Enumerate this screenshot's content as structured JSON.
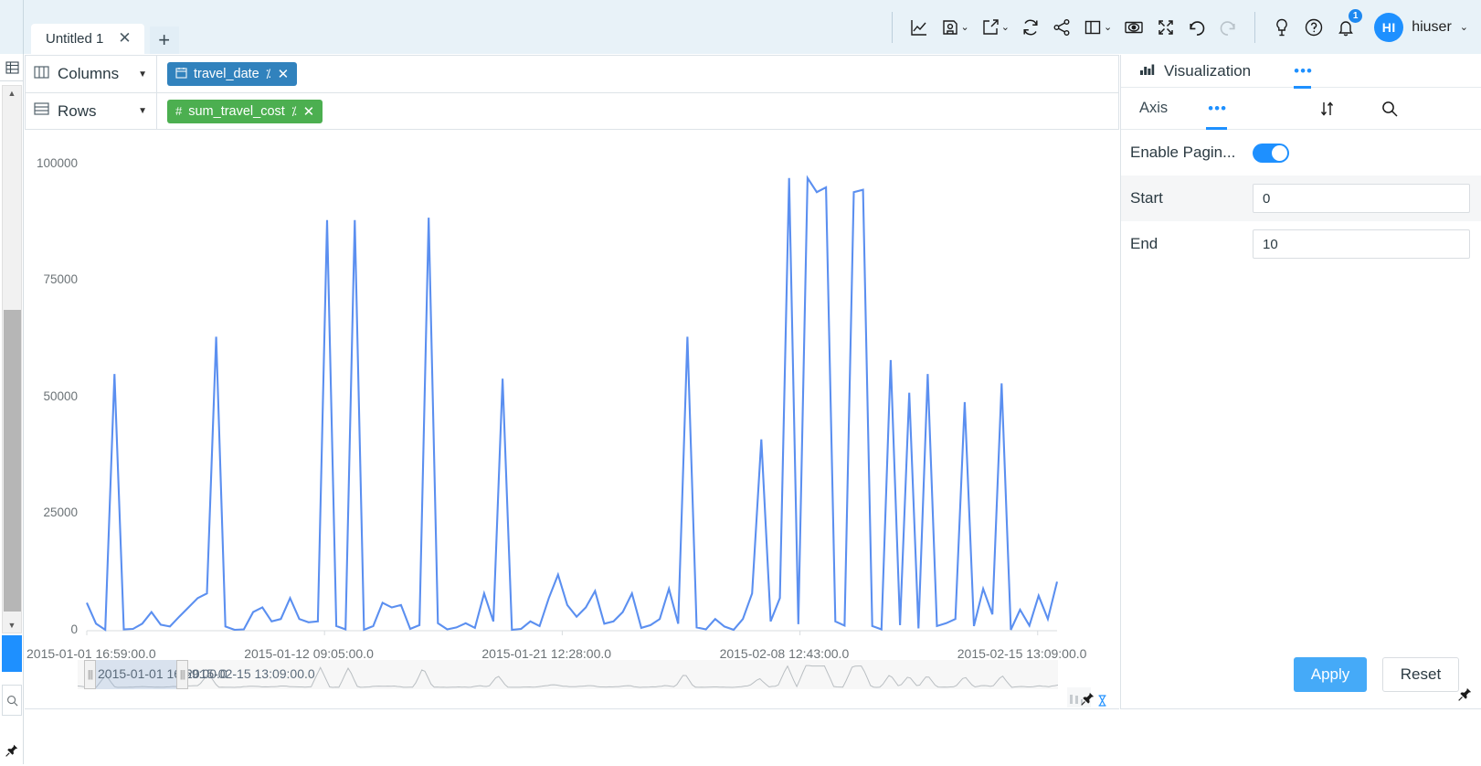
{
  "topbar": {
    "tabs": [
      {
        "label": "Untitled 1",
        "close": "✕"
      }
    ],
    "add_tab": "+",
    "tools": [
      {
        "name": "line-chart-icon",
        "caret": false
      },
      {
        "name": "save-icon",
        "caret": true
      },
      {
        "name": "export-icon",
        "caret": true
      },
      {
        "name": "refresh-icon",
        "caret": false
      },
      {
        "name": "share-icon",
        "caret": false
      },
      {
        "name": "layout-icon",
        "caret": true
      },
      {
        "name": "preview-eye-icon",
        "caret": false
      },
      {
        "name": "fullscreen-icon",
        "caret": false
      },
      {
        "name": "undo-icon",
        "caret": false
      },
      {
        "name": "redo-icon",
        "caret": false
      }
    ],
    "help_tools": [
      {
        "name": "lightbulb-icon"
      },
      {
        "name": "question-icon"
      }
    ],
    "notification_count": "1",
    "user": {
      "initials": "HI",
      "name": "hiuser",
      "caret": "⌄"
    }
  },
  "shelves": [
    {
      "label": "Columns",
      "icon": "columns-icon",
      "caret": "▼",
      "pill": {
        "label": "travel_date",
        "icon": "calendar-icon",
        "agg": "⁒",
        "close": "✕",
        "color": "#3182bd"
      }
    },
    {
      "label": "Rows",
      "icon": "rows-icon",
      "caret": "▼",
      "pill": {
        "label": "sum_travel_cost",
        "icon": "#",
        "agg": "⁒",
        "close": "✕",
        "color": "#4caf50"
      }
    }
  ],
  "chart_data": {
    "type": "line",
    "title": "",
    "xlabel": "travel_date",
    "ylabel": "sum_travel_cost",
    "line_color": "#5b8ff0",
    "grid": false,
    "legend": "none",
    "ylim": [
      0,
      105000
    ],
    "yticks": [
      "0",
      "25000",
      "50000",
      "75000",
      "100000"
    ],
    "ytick_values": [
      0,
      25000,
      50000,
      75000,
      100000
    ],
    "xticks": [
      "2015-01-01 16:59:00.0",
      "2015-01-12 09:05:00.0",
      "2015-01-21 12:28:00.0",
      "2015-02-08 12:43:00.0",
      "2015-02-15 13:09:00.0"
    ],
    "xtick_positions": [
      0,
      0.245,
      0.49,
      0.735,
      0.98
    ],
    "values": [
      6000,
      1500,
      200,
      55000,
      300,
      400,
      1500,
      4000,
      1300,
      900,
      3000,
      5000,
      7000,
      8000,
      63000,
      900,
      200,
      300,
      4000,
      5000,
      2000,
      2500,
      7000,
      2500,
      1800,
      2000,
      88000,
      1000,
      300,
      88000,
      200,
      1000,
      6000,
      5000,
      5500,
      400,
      1200,
      88500,
      1600,
      300,
      700,
      1600,
      600,
      8000,
      2000,
      54000,
      200,
      400,
      2000,
      1000,
      7000,
      12000,
      5500,
      3000,
      5000,
      8500,
      1500,
      2000,
      4000,
      8000,
      600,
      1200,
      2500,
      9000,
      1500,
      63000,
      700,
      300,
      2500,
      900,
      200,
      2500,
      8000,
      41000,
      2000,
      7000,
      97000,
      1400,
      97000,
      94000,
      95000,
      2000,
      1100,
      94000,
      94500,
      1000,
      300,
      58000,
      1200,
      51000,
      500,
      55000,
      1000,
      1600,
      2500,
      49000,
      1000,
      9000,
      3500,
      53000,
      200,
      4500,
      1100,
      7500,
      2500,
      10500
    ]
  },
  "brush": {
    "start_label": "2015-01-01 16:59:00.0",
    "end_label": "2015-02-15 13:09:00.0",
    "handle_grip": "|||"
  },
  "right_panel": {
    "header": {
      "title": "Visualization",
      "icon": "chart-icon",
      "dots": "•••"
    },
    "tabs": {
      "axis": "Axis",
      "dots": "•••",
      "sort_icon": "sort-icon",
      "search_icon": "search-icon"
    },
    "rows": [
      {
        "label": "Enable Pagin...",
        "type": "toggle",
        "value": "on"
      },
      {
        "label": "Start",
        "type": "input",
        "value": "0"
      },
      {
        "label": "End",
        "type": "input",
        "value": "10"
      }
    ],
    "footer": {
      "apply": "Apply",
      "reset": "Reset"
    }
  },
  "left_rail": {
    "table_icon": "table-icon",
    "up_arrow": "▲",
    "down_arrow": "▼",
    "search_icon": "search-icon",
    "pin_icon": "pin-icon"
  },
  "colors": {
    "accent": "#1e90ff",
    "topbar_bg": "#e8f2f8",
    "line": "#5b8ff0",
    "columns_pill": "#3182bd",
    "rows_pill": "#4caf50"
  }
}
